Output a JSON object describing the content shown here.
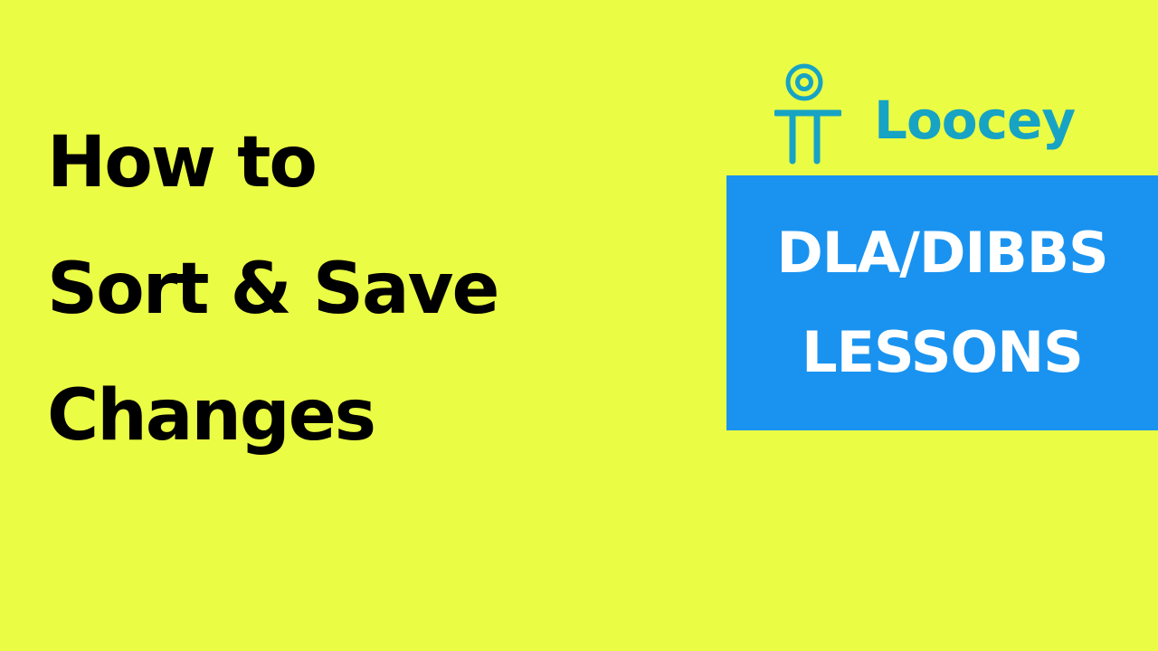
{
  "colors": {
    "background": "#ebfc44",
    "headline_text": "#000000",
    "brand_teal": "#17a3c4",
    "lesson_box": "#1a93f0",
    "lesson_text": "#ffffff"
  },
  "headline": {
    "line1": "How to",
    "line2": "Sort & Save",
    "line3": "Changes"
  },
  "brand": {
    "name": "Loocey",
    "icon": "loocey-logo-icon"
  },
  "lesson_box": {
    "line1": "DLA/DIBBS",
    "line2": "LESSONS"
  }
}
